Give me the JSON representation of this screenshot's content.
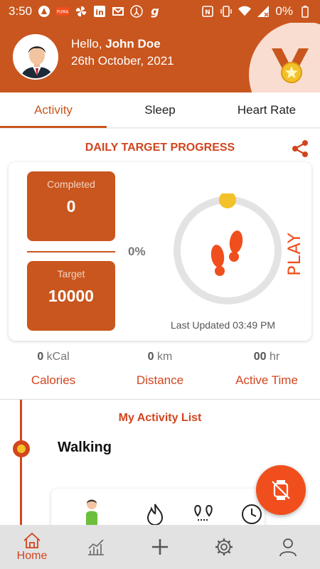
{
  "status_bar": {
    "time": "3:50",
    "battery": "0%",
    "app_icons": [
      "alert-icon",
      "puma-icon",
      "pinwheel-icon",
      "linkedin-icon",
      "gmail-icon",
      "fitness-icon",
      "g-icon"
    ],
    "system_icons": [
      "nfc-icon",
      "vibrate-icon",
      "wifi-icon",
      "signal-icon",
      "battery-icon"
    ]
  },
  "header": {
    "greeting": "Hello,",
    "user_name": "John Doe",
    "date": "26th October, 2021"
  },
  "tabs": [
    {
      "label": "Activity",
      "active": true
    },
    {
      "label": "Sleep"
    },
    {
      "label": "Heart Rate"
    }
  ],
  "daily": {
    "title": "DAILY TARGET PROGRESS",
    "completed_label": "Completed",
    "completed_value": "0",
    "target_label": "Target",
    "target_value": "10000",
    "percent": "0%",
    "progress_fraction": 0,
    "play_label": "PLAY",
    "last_updated": "Last Updated 03:49 PM"
  },
  "stats": [
    {
      "value": "0",
      "unit": "kCal",
      "name": "Calories"
    },
    {
      "value": "0",
      "unit": "km",
      "name": "Distance"
    },
    {
      "value": "00",
      "unit": "hr",
      "name": "Active Time"
    }
  ],
  "activity_list": {
    "title": "My Activity List",
    "items": [
      {
        "name": "Walking"
      }
    ]
  },
  "bottom_nav": [
    {
      "label": "Home",
      "icon": "home-icon",
      "active": true
    },
    {
      "label": "",
      "icon": "chart-icon"
    },
    {
      "label": "",
      "icon": "plus-icon"
    },
    {
      "label": "",
      "icon": "gear-icon"
    },
    {
      "label": "",
      "icon": "profile-icon"
    }
  ],
  "colors": {
    "primary": "#c9561e",
    "accent": "#d2451e",
    "fab": "#f04f1d",
    "gold": "#f3c12a"
  }
}
